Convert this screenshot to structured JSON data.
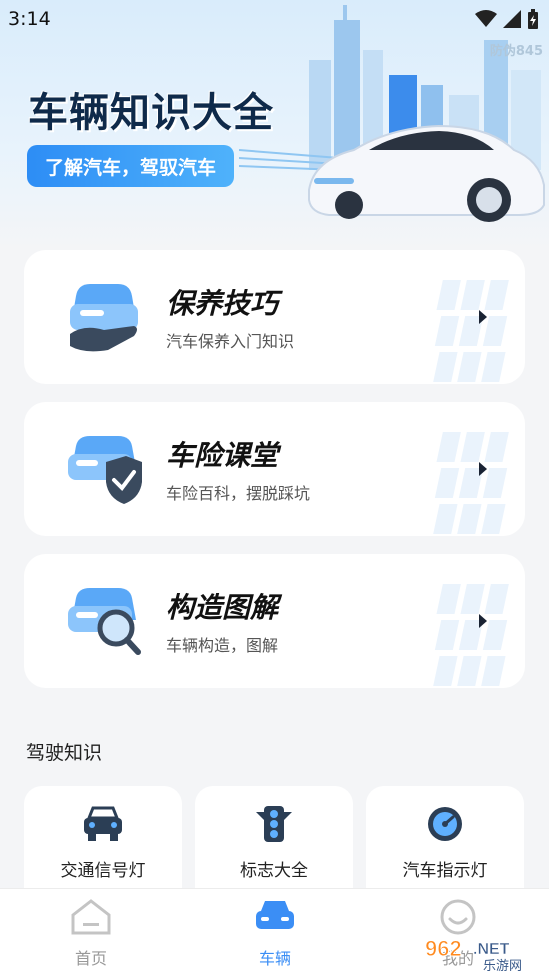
{
  "status_bar": {
    "time": "3:14"
  },
  "hero": {
    "title": "车辆知识大全",
    "pill": "了解汽车，驾驭汽车",
    "watermark": "防伪845"
  },
  "cards": [
    {
      "title": "保养技巧",
      "subtitle": "汽车保养入门知识",
      "icon": "car-hand-icon"
    },
    {
      "title": "车险课堂",
      "subtitle": "车险百科，摆脱踩坑",
      "icon": "car-shield-icon"
    },
    {
      "title": "构造图解",
      "subtitle": "车辆构造，图解",
      "icon": "car-magnifier-icon"
    }
  ],
  "section": {
    "title": "驾驶知识"
  },
  "tiles": [
    {
      "label": "交通信号灯",
      "icon": "car-front-icon"
    },
    {
      "label": "标志大全",
      "icon": "traffic-light-icon"
    },
    {
      "label": "汽车指示灯",
      "icon": "speedometer-icon"
    }
  ],
  "tabbar": {
    "items": [
      {
        "label": "首页",
        "icon": "home-icon",
        "active": false
      },
      {
        "label": "车辆",
        "icon": "car-icon",
        "active": true
      },
      {
        "label": "我的",
        "icon": "profile-icon",
        "active": false
      }
    ]
  },
  "watermark_bottom": {
    "logo": "962.NET",
    "text": "乐游网"
  },
  "colors": {
    "accent": "#3b8ef5",
    "inactive": "#999999",
    "title": "#0f2a4a"
  }
}
